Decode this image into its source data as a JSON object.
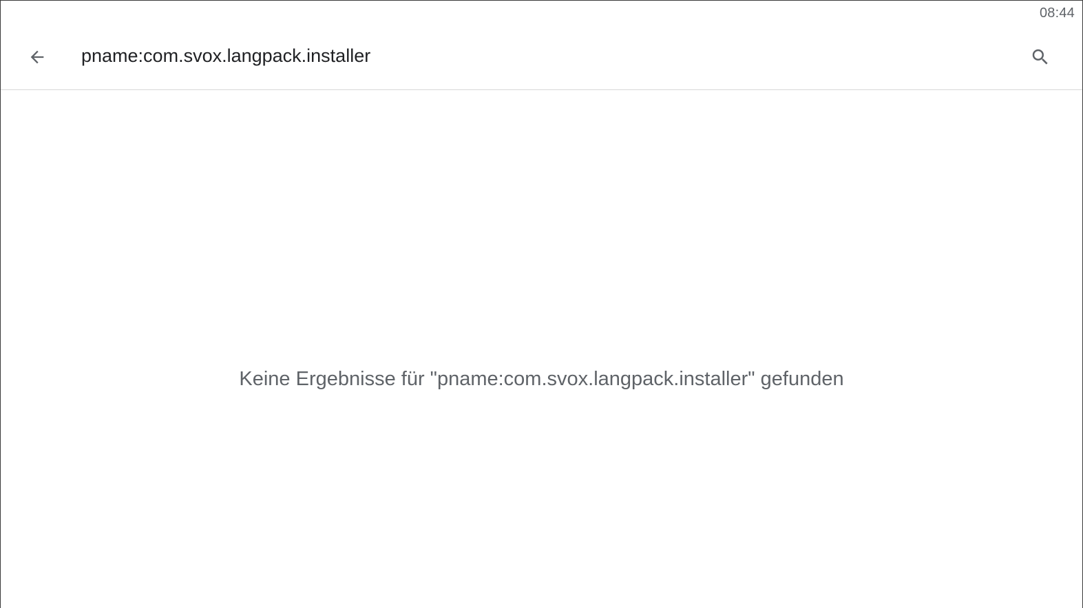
{
  "status_bar": {
    "time": "08:44"
  },
  "app_bar": {
    "back_icon": "arrow-back-icon",
    "search_query": "pname:com.svox.langpack.installer",
    "search_icon": "search-icon"
  },
  "results": {
    "empty_message": "Keine Ergebnisse für \"pname:com.svox.langpack.installer\" gefunden"
  },
  "colors": {
    "primary_text": "#202124",
    "secondary_text": "#5f6368",
    "icon": "#5f6368",
    "divider": "#d7d7d7",
    "background": "#ffffff"
  }
}
